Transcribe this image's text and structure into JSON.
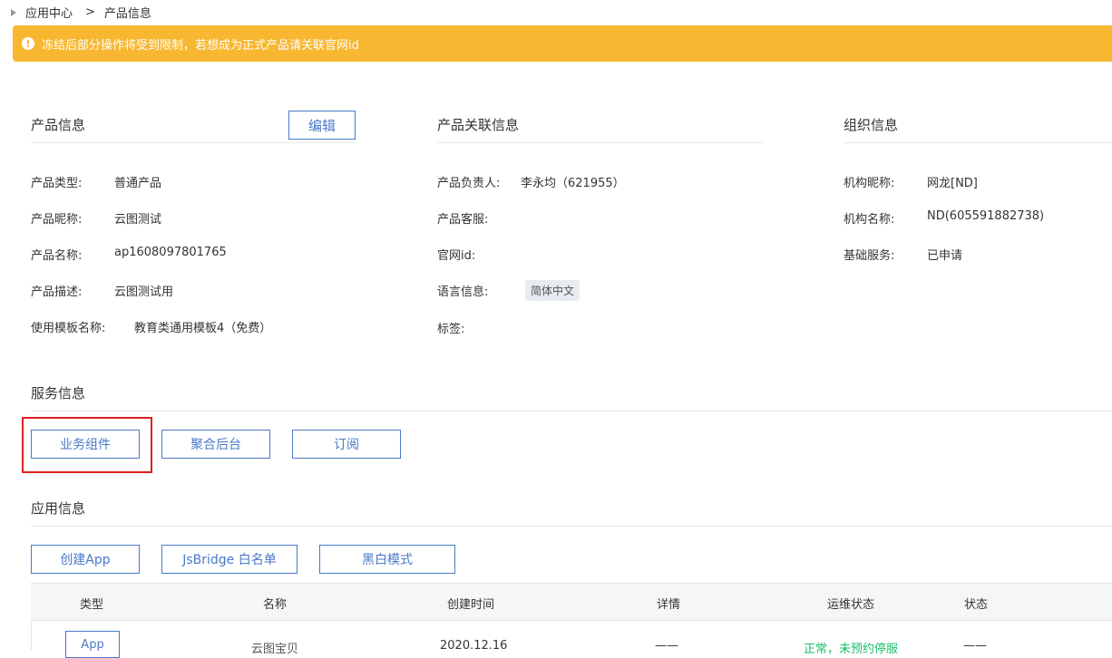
{
  "breadcrumb": {
    "root": "应用中心",
    "separator": ">",
    "current": "产品信息"
  },
  "warning": {
    "icon": "!",
    "text": "冻结后部分操作将受到限制，若想成为正式产品请关联官网id"
  },
  "product_info": {
    "title": "产品信息",
    "edit_label": "编辑",
    "fields": [
      {
        "label": "产品类型:",
        "value": "普通产品"
      },
      {
        "label": "产品昵称:",
        "value": "云图测试"
      },
      {
        "label": "产品名称:",
        "value": "ap1608097801765"
      },
      {
        "label": "产品描述:",
        "value": "云图测试用"
      },
      {
        "label": "使用模板名称:",
        "value": "教育类通用模板4（免费）"
      }
    ]
  },
  "related_info": {
    "title": "产品关联信息",
    "fields": [
      {
        "label": "产品负责人:",
        "value": "李永均（621955）"
      },
      {
        "label": "产品客服:",
        "value": ""
      },
      {
        "label": "官网id:",
        "value": ""
      },
      {
        "label": "语言信息:",
        "value": "简体中文"
      },
      {
        "label": "标签:",
        "value": ""
      }
    ]
  },
  "org_info": {
    "title": "组织信息",
    "fields": [
      {
        "label": "机构昵称:",
        "value": "网龙[ND]"
      },
      {
        "label": "机构名称:",
        "value": "ND(605591882738)"
      },
      {
        "label": "基础服务:",
        "value": "已申请"
      }
    ]
  },
  "service_info": {
    "title": "服务信息",
    "buttons": [
      "业务组件",
      "聚合后台",
      "订阅"
    ]
  },
  "app_info": {
    "title": "应用信息",
    "buttons": [
      "创建App",
      "JsBridge 白名单",
      "黑白模式"
    ],
    "columns": [
      "类型",
      "名称",
      "创建时间",
      "详情",
      "运维状态",
      "状态"
    ],
    "rows": [
      {
        "type": "App",
        "name": "云图宝贝",
        "created": "2020.12.16",
        "detail": "——",
        "ops_status": "正常，未预约停服",
        "status": "——"
      }
    ]
  },
  "colors": {
    "warning": "#f7b731",
    "accent": "#4a79c9",
    "highlight": "#e02020",
    "ok": "#19be6b"
  }
}
